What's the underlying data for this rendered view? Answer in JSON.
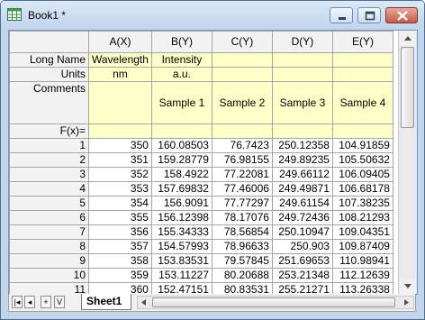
{
  "window": {
    "title": "Book1 *"
  },
  "columns": [
    "A(X)",
    "B(Y)",
    "C(Y)",
    "D(Y)",
    "E(Y)"
  ],
  "meta_rows": [
    {
      "label": "Long Name",
      "values": [
        "Wavelength",
        "Intensity",
        "",
        "",
        ""
      ]
    },
    {
      "label": "Units",
      "values": [
        "nm",
        "a.u.",
        "",
        "",
        ""
      ]
    },
    {
      "label": "Comments",
      "values": [
        "",
        "Sample 1",
        "Sample 2",
        "Sample 3",
        "Sample 4"
      ]
    },
    {
      "label": "F(x)=",
      "values": [
        "",
        "",
        "",
        "",
        ""
      ]
    }
  ],
  "data_rows": [
    {
      "row": "1",
      "values": [
        "350",
        "160.08503",
        "76.7423",
        "250.12358",
        "104.91859"
      ]
    },
    {
      "row": "2",
      "values": [
        "351",
        "159.28779",
        "76.98155",
        "249.89235",
        "105.50632"
      ]
    },
    {
      "row": "3",
      "values": [
        "352",
        "158.4922",
        "77.22081",
        "249.66112",
        "106.09405"
      ]
    },
    {
      "row": "4",
      "values": [
        "353",
        "157.69832",
        "77.46006",
        "249.49871",
        "106.68178"
      ]
    },
    {
      "row": "5",
      "values": [
        "354",
        "156.9091",
        "77.77297",
        "249.61154",
        "107.38235"
      ]
    },
    {
      "row": "6",
      "values": [
        "355",
        "156.12398",
        "78.17076",
        "249.72436",
        "108.21293"
      ]
    },
    {
      "row": "7",
      "values": [
        "356",
        "155.34333",
        "78.56854",
        "250.10947",
        "109.04351"
      ]
    },
    {
      "row": "8",
      "values": [
        "357",
        "154.57993",
        "78.96633",
        "250.903",
        "109.87409"
      ]
    },
    {
      "row": "9",
      "values": [
        "358",
        "153.83531",
        "79.57845",
        "251.69653",
        "110.98941"
      ]
    },
    {
      "row": "10",
      "values": [
        "359",
        "153.11227",
        "80.20688",
        "253.21348",
        "112.12639"
      ]
    },
    {
      "row": "11",
      "values": [
        "360",
        "152.47151",
        "80.83531",
        "255.21271",
        "113.26338"
      ]
    }
  ],
  "sheet_tabs": [
    {
      "label": "Sheet1"
    }
  ],
  "nav": {
    "first": "|◂",
    "prev": "◂",
    "add": "+",
    "menu": "V"
  }
}
